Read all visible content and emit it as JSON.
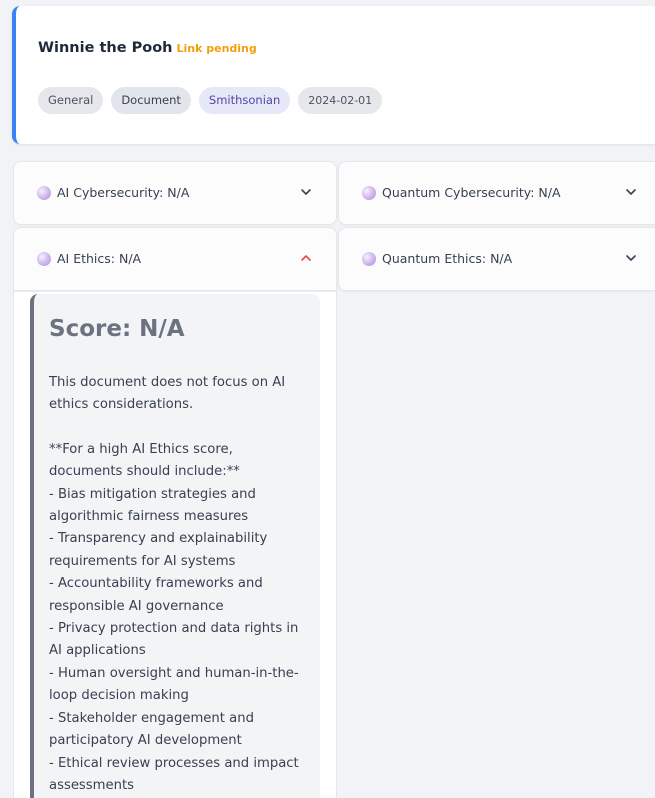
{
  "document": {
    "title": "Winnie the Pooh",
    "link_status": "Link pending",
    "tags": {
      "category": "General",
      "type": "Document",
      "source": "Smithsonian",
      "date": "2024-02-01"
    }
  },
  "accordions": {
    "ai_cybersecurity": {
      "label": "AI Cybersecurity: N/A",
      "expanded": false
    },
    "quantum_cybersecurity": {
      "label": "Quantum Cybersecurity: N/A",
      "expanded": false
    },
    "ai_ethics": {
      "label": "AI Ethics: N/A",
      "expanded": true
    },
    "quantum_ethics": {
      "label": "Quantum Ethics: N/A",
      "expanded": false
    }
  },
  "ai_ethics_panel": {
    "score_title": "Score: N/A",
    "summary": "This document does not focus on AI ethics considerations.",
    "criteria_heading": "**For a high AI Ethics score, documents should include:**",
    "criteria": [
      "- Bias mitigation strategies and algorithmic fairness measures",
      "- Transparency and explainability requirements for AI systems",
      "- Accountability frameworks and responsible AI governance",
      "- Privacy protection and data rights in AI applications",
      "- Human oversight and human-in-the-loop decision making",
      "- Stakeholder engagement and participatory AI development",
      "- Ethical review processes and impact assessments"
    ]
  },
  "colors": {
    "accent_blue": "#3b82f6",
    "pending_orange": "#f59e0b",
    "chevron_open": "#ef4444",
    "score_border": "#6b7280"
  },
  "icons": {
    "status_dot": "score-status-dot-icon",
    "collapsed": "chevron-down-icon",
    "expanded": "chevron-up-icon"
  }
}
